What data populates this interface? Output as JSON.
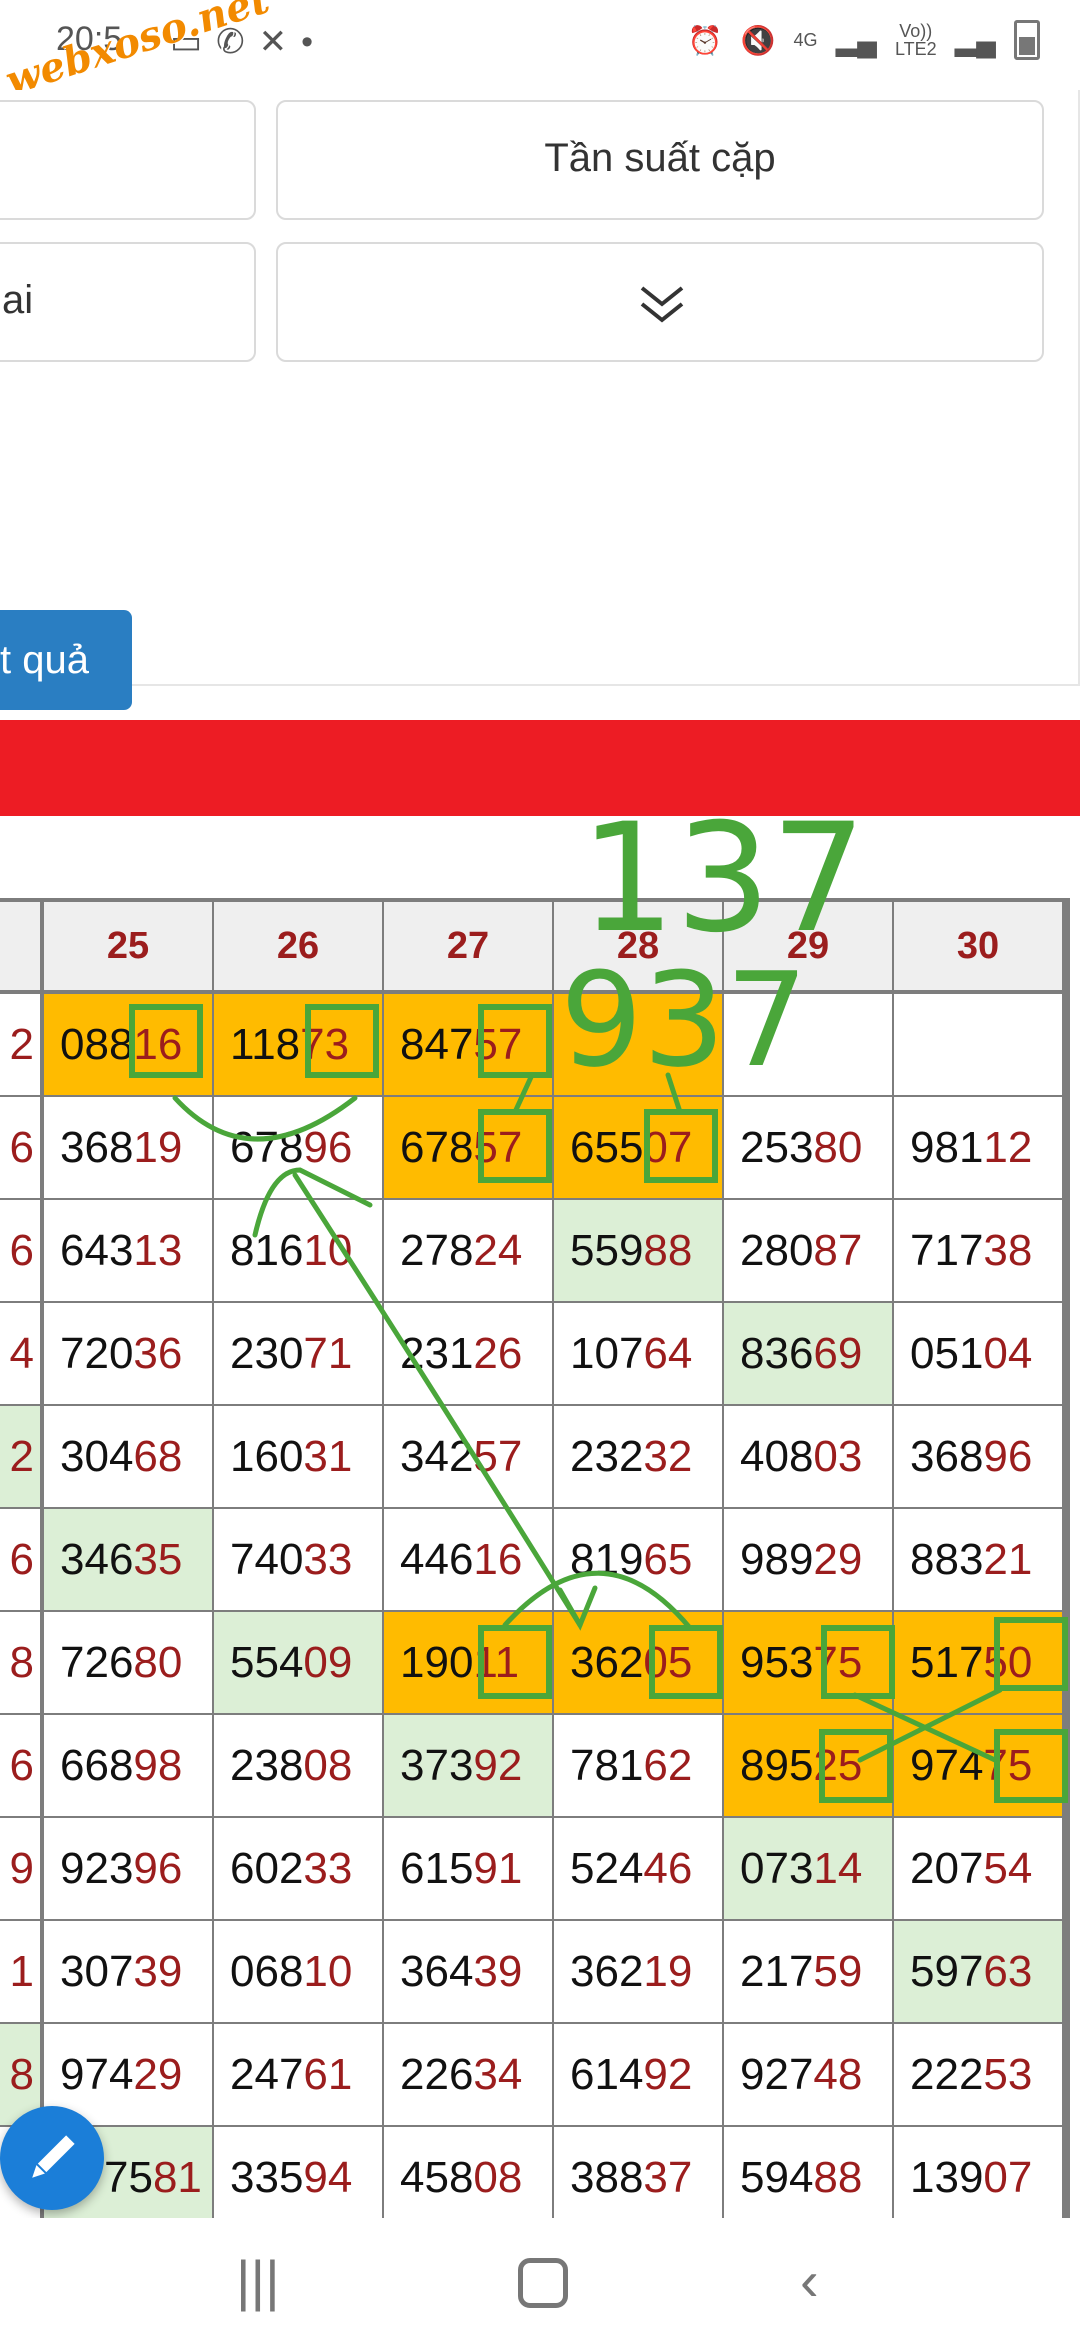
{
  "status_bar": {
    "time": "20:5",
    "network": "4G",
    "volte": "Vo))",
    "lte": "LTE2"
  },
  "watermark": "webxoso.net",
  "form": {
    "button_top_right": "Tần suất cặp",
    "partial_left_text": "ai",
    "submit_label": "t quả"
  },
  "table": {
    "headers": [
      "25",
      "26",
      "27",
      "28",
      "29",
      "30"
    ],
    "left_edge": [
      "2",
      "6",
      "6",
      "4",
      "2",
      "6",
      "8",
      "6",
      "9",
      "1",
      "8",
      "."
    ],
    "rows": [
      [
        "08816",
        "11873",
        "84757",
        "",
        "",
        ""
      ],
      [
        "36819",
        "67896",
        "67857",
        "65507",
        "25380",
        "98112"
      ],
      [
        "64313",
        "81610",
        "27824",
        "55988",
        "28087",
        "71738"
      ],
      [
        "72036",
        "23071",
        "23126",
        "10764",
        "83669",
        "05104"
      ],
      [
        "30468",
        "16031",
        "34257",
        "23232",
        "40803",
        "36896"
      ],
      [
        "34635",
        "74033",
        "44616",
        "81965",
        "98929",
        "88321"
      ],
      [
        "72680",
        "55409",
        "19011",
        "36205",
        "95375",
        "51750"
      ],
      [
        "66898",
        "23808",
        "37392",
        "78162",
        "89525",
        "97475"
      ],
      [
        "92396",
        "60233",
        "61591",
        "52446",
        "07314",
        "20754"
      ],
      [
        "30739",
        "06810",
        "36439",
        "36219",
        "21759",
        "59763"
      ],
      [
        "97429",
        "24761",
        "22634",
        "61492",
        "92748",
        "22253"
      ],
      [
        "7581",
        "33594",
        "45808",
        "38837",
        "59488",
        "13907"
      ]
    ]
  },
  "annotations": {
    "line1": "137",
    "line2": "937"
  },
  "colors": {
    "accent_red": "#ed1c24",
    "highlight_orange": "#ffbb00",
    "highlight_green": "#dcefd6",
    "submit_blue": "#2a7ec2",
    "number_tail": "#9b1d1d"
  }
}
